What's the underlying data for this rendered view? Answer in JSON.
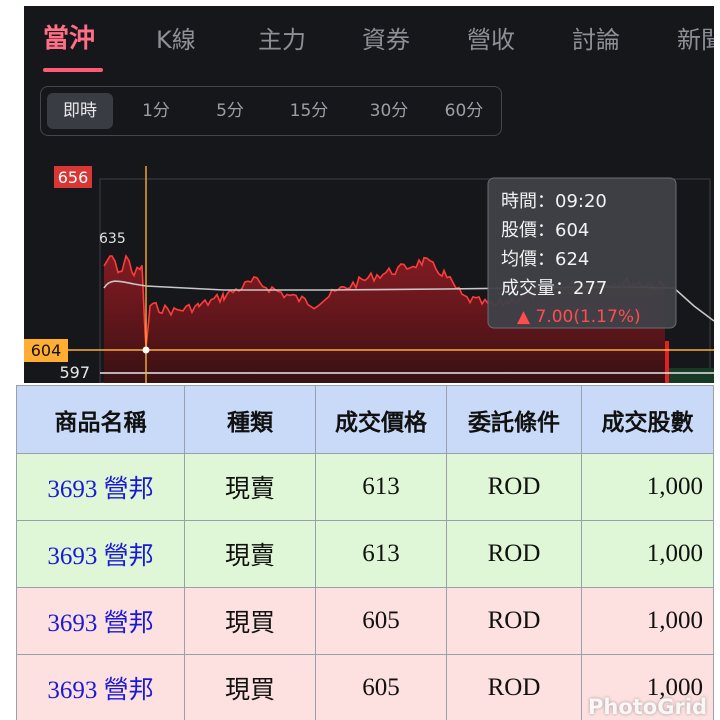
{
  "tabs": [
    "當沖",
    "K線",
    "主力",
    "資券",
    "營收",
    "討論",
    "新聞"
  ],
  "active_tab": 0,
  "intervals": [
    "即時",
    "1分",
    "5分",
    "15分",
    "30分",
    "60分"
  ],
  "active_interval": 0,
  "chart": {
    "high_label": "656",
    "peak_label": "635",
    "cursor_price_label": "604",
    "low_label": "597",
    "colors": {
      "price_line": "#ff3b3b",
      "average_line": "#c8c8c8",
      "cursor": "#ffad33",
      "high_badge": "#d93636"
    },
    "tooltip": {
      "time": "時間：09:20",
      "price": "股價：604",
      "avg": "均價：624",
      "volume": "成交量：277",
      "change": "▲ 7.00(1.17%)"
    }
  },
  "table": {
    "headers": [
      "商品名稱",
      "種類",
      "成交價格",
      "委託條件",
      "成交股數"
    ],
    "rows": [
      {
        "side": "sell",
        "name": "3693 營邦",
        "type": "現賣",
        "price": "613",
        "condition": "ROD",
        "qty": "1,000"
      },
      {
        "side": "sell",
        "name": "3693 營邦",
        "type": "現賣",
        "price": "613",
        "condition": "ROD",
        "qty": "1,000"
      },
      {
        "side": "buy",
        "name": "3693 營邦",
        "type": "現買",
        "price": "605",
        "condition": "ROD",
        "qty": "1,000"
      },
      {
        "side": "buy",
        "name": "3693 營邦",
        "type": "現買",
        "price": "605",
        "condition": "ROD",
        "qty": "1,000"
      }
    ]
  },
  "watermark": "PhotoGrid"
}
